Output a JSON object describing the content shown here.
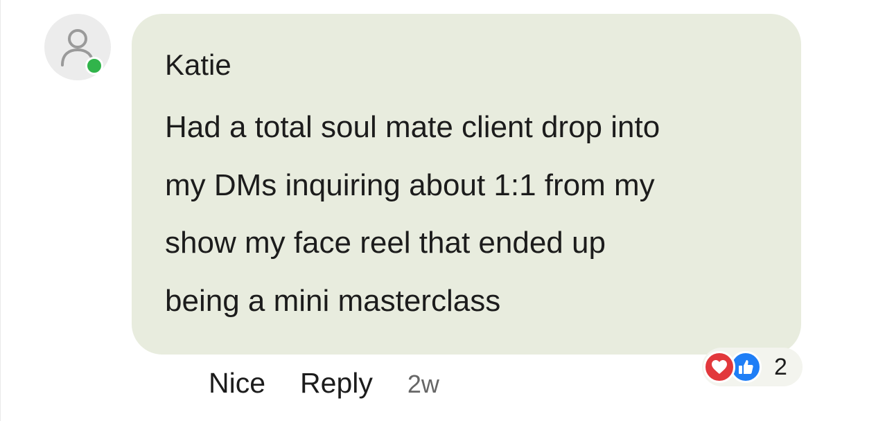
{
  "comment": {
    "author": "Katie",
    "lines": [
      "Had a total soul mate client drop into",
      "my DMs inquiring about 1:1 from my",
      "show my face reel that ended up",
      "being a mini masterclass"
    ],
    "online": true
  },
  "reactions": {
    "icons": [
      "heart-icon",
      "thumbs-up-icon"
    ],
    "count": "2"
  },
  "actions": {
    "react_label": "Nice",
    "reply_label": "Reply",
    "timestamp": "2w"
  },
  "colors": {
    "bubble": "#e8ecde",
    "online": "#31b44b",
    "heart": "#e2383c",
    "like": "#1f7ef6"
  }
}
